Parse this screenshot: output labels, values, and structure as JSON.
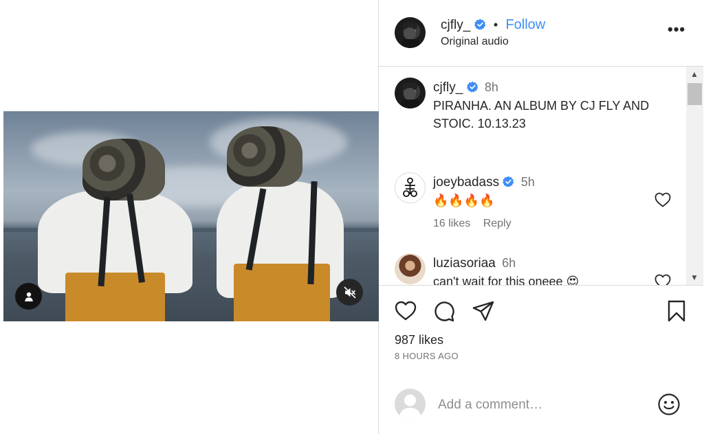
{
  "post": {
    "username": "cjfly_",
    "follow_label": "Follow",
    "separator": "•",
    "audio": "Original audio",
    "more_label": "•••",
    "caption": {
      "username": "cjfly_",
      "time": "8h",
      "text": "PIRANHA. AN ALBUM BY CJ FLY AND STOIC. 10.13.23"
    },
    "comments": [
      {
        "username": "joeybadass",
        "time": "5h",
        "text": "🔥🔥🔥🔥",
        "likes": "16 likes",
        "reply": "Reply"
      },
      {
        "username": "luziasoriaa",
        "time": "6h",
        "text": "can't wait for this oneee 😍",
        "likes": "",
        "reply": ""
      }
    ],
    "likes_count": "987 likes",
    "time_ago": "8 HOURS AGO",
    "add_comment_placeholder": "Add a comment…"
  },
  "colors": {
    "accent": "#3f8ef5",
    "verified": "#3f8ef5",
    "border": "#dbdbdb",
    "muted_text": "#737373"
  },
  "icons": [
    "user-icon",
    "mute-icon",
    "verified-icon",
    "heart-icon",
    "comment-icon",
    "share-icon",
    "bookmark-icon",
    "emoji-icon",
    "more-icon",
    "scroll-up-icon",
    "scroll-down-icon"
  ]
}
